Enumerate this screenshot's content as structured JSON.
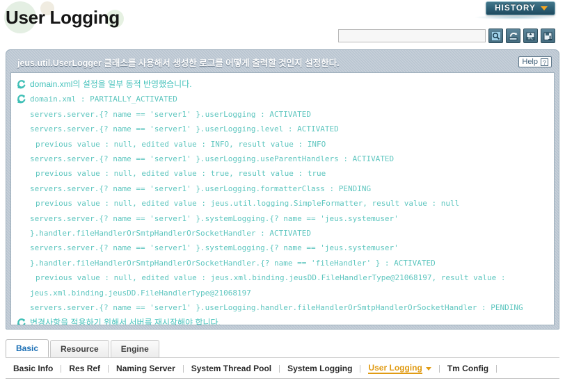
{
  "header": {
    "page_title": "User Logging",
    "history_button": "HISTORY",
    "history_caret_icon": "chevron-down-icon",
    "accent_orange": "#e09b14",
    "accent_teal": "#5ec6bf",
    "history_bg": "#2e6076"
  },
  "search": {
    "value": "",
    "placeholder": "",
    "tools": [
      {
        "name": "search-icon",
        "title": "Search"
      },
      {
        "name": "refresh-icon",
        "title": "Refresh"
      },
      {
        "name": "xml-export-icon",
        "title": "Export XML"
      },
      {
        "name": "save-icon",
        "title": "Save"
      }
    ]
  },
  "panel": {
    "title": "jeus.util.UserLogger 클래스를 사용해서 생성한 로그를 어떻게 출력할 것인지 설정한다.",
    "help_label": "Help",
    "help_mark": "?"
  },
  "log": {
    "lines": [
      {
        "icon": "refresh-icon",
        "indent": 0,
        "lang": "kr",
        "text": "domain.xml의 설정을 일부 동적 반영했습니다."
      },
      {
        "icon": "refresh-icon",
        "indent": 0,
        "lang": "mono",
        "text": "domain.xml : PARTIALLY_ACTIVATED"
      },
      {
        "icon": "none",
        "indent": 1,
        "lang": "mono",
        "text": "servers.server.{? name == 'server1' }.userLogging : ACTIVATED"
      },
      {
        "icon": "none",
        "indent": 1,
        "lang": "mono",
        "text": "servers.server.{? name == 'server1' }.userLogging.level : ACTIVATED"
      },
      {
        "icon": "none",
        "indent": 2,
        "lang": "mono",
        "text": "previous value : null, edited value : INFO, result value : INFO"
      },
      {
        "icon": "none",
        "indent": 1,
        "lang": "mono",
        "text": "servers.server.{? name == 'server1' }.userLogging.useParentHandlers : ACTIVATED"
      },
      {
        "icon": "none",
        "indent": 2,
        "lang": "mono",
        "text": "previous value : null, edited value : true, result value : true"
      },
      {
        "icon": "none",
        "indent": 1,
        "lang": "mono",
        "text": "servers.server.{? name == 'server1' }.userLogging.formatterClass : PENDING"
      },
      {
        "icon": "none",
        "indent": 2,
        "lang": "mono",
        "text": "previous value : null, edited value : jeus.util.logging.SimpleFormatter, result value : null"
      },
      {
        "icon": "none",
        "indent": 1,
        "lang": "mono",
        "text": "servers.server.{? name == 'server1' }.systemLogging.{? name == 'jeus.systemuser'"
      },
      {
        "icon": "none",
        "indent": 1,
        "lang": "mono",
        "text": "}.handler.fileHandlerOrSmtpHandlerOrSocketHandler : ACTIVATED"
      },
      {
        "icon": "none",
        "indent": 1,
        "lang": "mono",
        "text": "servers.server.{? name == 'server1' }.systemLogging.{? name == 'jeus.systemuser'"
      },
      {
        "icon": "none",
        "indent": 1,
        "lang": "mono",
        "text": "}.handler.fileHandlerOrSmtpHandlerOrSocketHandler.{? name == 'fileHandler' } : ACTIVATED"
      },
      {
        "icon": "none",
        "indent": 2,
        "lang": "mono",
        "text": "previous value : null, edited value : jeus.xml.binding.jeusDD.FileHandlerType@21068197, result value :"
      },
      {
        "icon": "none",
        "indent": 1,
        "lang": "mono",
        "text": "jeus.xml.binding.jeusDD.FileHandlerType@21068197"
      },
      {
        "icon": "none",
        "indent": 1,
        "lang": "mono",
        "text": "servers.server.{? name == 'server1' }.userLogging.handler.fileHandlerOrSmtpHandlerOrSocketHandler : PENDING"
      },
      {
        "icon": "refresh-icon",
        "indent": 0,
        "lang": "kr",
        "text": "변경사항을 적용하기 위해서 서버를 재시작해야 합니다."
      }
    ]
  },
  "tabs": [
    {
      "label": "Basic",
      "active": true
    },
    {
      "label": "Resource",
      "active": false
    },
    {
      "label": "Engine",
      "active": false
    }
  ],
  "subnav": [
    {
      "label": "Basic Info",
      "current": false,
      "caret": false
    },
    {
      "label": "Res Ref",
      "current": false,
      "caret": false
    },
    {
      "label": "Naming Server",
      "current": false,
      "caret": false
    },
    {
      "label": "System Thread Pool",
      "current": false,
      "caret": false
    },
    {
      "label": "System Logging",
      "current": false,
      "caret": false
    },
    {
      "label": "User Logging",
      "current": true,
      "caret": true
    },
    {
      "label": "Tm Config",
      "current": false,
      "caret": false
    }
  ]
}
